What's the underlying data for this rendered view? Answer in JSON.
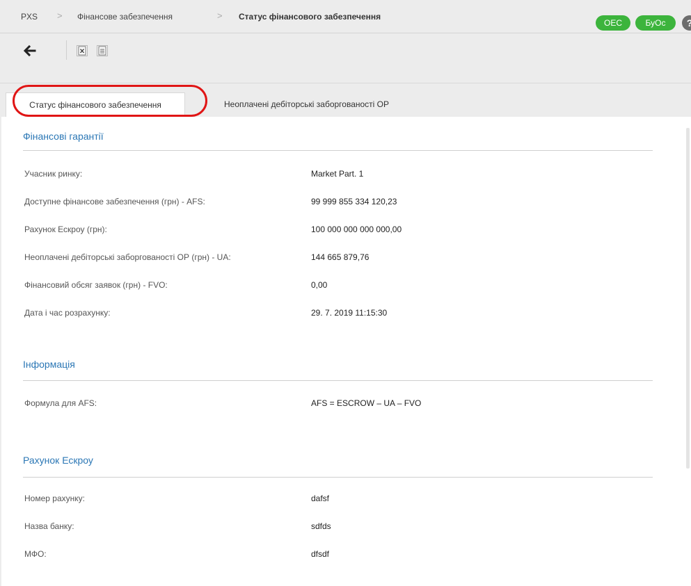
{
  "breadcrumb": {
    "items": [
      "PXS",
      "Фінансове забезпечення",
      "Статус фінансового забезпечення"
    ],
    "separator": ">"
  },
  "badges": [
    "OEC",
    "БуОс"
  ],
  "help_icon": "?",
  "toolbar": {
    "back_icon": "arrow-left",
    "buttons": [
      "excel-export-icon",
      "document-export-icon"
    ]
  },
  "tabs": [
    {
      "label": "Статус фінансового забезпечення",
      "active": true
    },
    {
      "label": "Неоплачені дебіторські заборгованості ОР",
      "active": false
    }
  ],
  "sections": {
    "guarantees": {
      "title": "Фінансові гарантії",
      "rows": [
        {
          "label": "Учасник ринку:",
          "value": "Market Part. 1"
        },
        {
          "label": "Доступне фінансове забезпечення (грн) - AFS:",
          "value": "99 999 855 334 120,23"
        },
        {
          "label": "Рахунок Ескроу (грн):",
          "value": "100 000 000 000 000,00"
        },
        {
          "label": "Неоплачені дебіторські заборгованості ОР (грн) - UA:",
          "value": "144 665 879,76"
        },
        {
          "label": "Фінансовий обсяг заявок (грн) - FVO:",
          "value": "0,00"
        },
        {
          "label": "Дата і час розрахунку:",
          "value": "29. 7. 2019 11:15:30"
        }
      ]
    },
    "info": {
      "title": "Інформація",
      "rows": [
        {
          "label": "Формула для AFS:",
          "value": "AFS = ESCROW – UA – FVO"
        }
      ]
    },
    "escrow": {
      "title": "Рахунок Ескроу",
      "rows": [
        {
          "label": "Номер рахунку:",
          "value": "dafsf"
        },
        {
          "label": "Назва банку:",
          "value": "sdfds"
        },
        {
          "label": "МФО:",
          "value": "dfsdf"
        }
      ]
    }
  },
  "colors": {
    "badge": "#3cb43c",
    "section_title": "#2b77b5",
    "highlight_ring": "#e01515"
  }
}
